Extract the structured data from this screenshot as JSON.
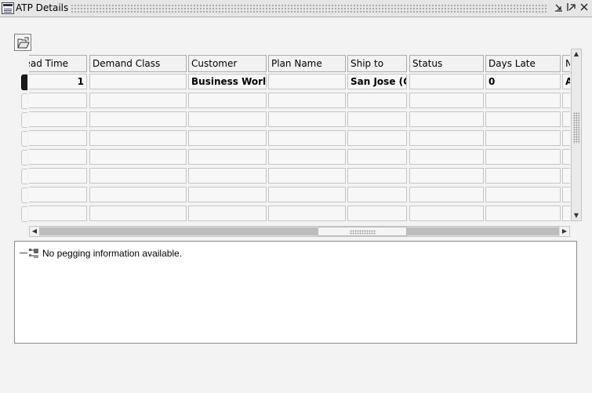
{
  "window": {
    "title": "ATP Details",
    "controls": [
      "minimize-icon",
      "maximize-icon",
      "close-icon"
    ]
  },
  "toolbar": {
    "open_icon": "open-folder-icon"
  },
  "grid": {
    "columns": [
      "Lead Time",
      "Demand Class",
      "Customer",
      "Plan Name",
      "Ship to",
      "Status",
      "Days Late",
      "N"
    ],
    "rows": [
      [
        "1",
        "",
        "Business World",
        "",
        "San Jose (C",
        "",
        "0",
        "A"
      ],
      [
        "",
        "",
        "",
        "",
        "",
        "",
        "",
        ""
      ],
      [
        "",
        "",
        "",
        "",
        "",
        "",
        "",
        ""
      ],
      [
        "",
        "",
        "",
        "",
        "",
        "",
        "",
        ""
      ],
      [
        "",
        "",
        "",
        "",
        "",
        "",
        "",
        ""
      ],
      [
        "",
        "",
        "",
        "",
        "",
        "",
        "",
        ""
      ],
      [
        "",
        "",
        "",
        "",
        "",
        "",
        "",
        ""
      ],
      [
        "",
        "",
        "",
        "",
        "",
        "",
        "",
        ""
      ]
    ],
    "current_row": 0
  },
  "pegging": {
    "message": "No pegging information available."
  }
}
